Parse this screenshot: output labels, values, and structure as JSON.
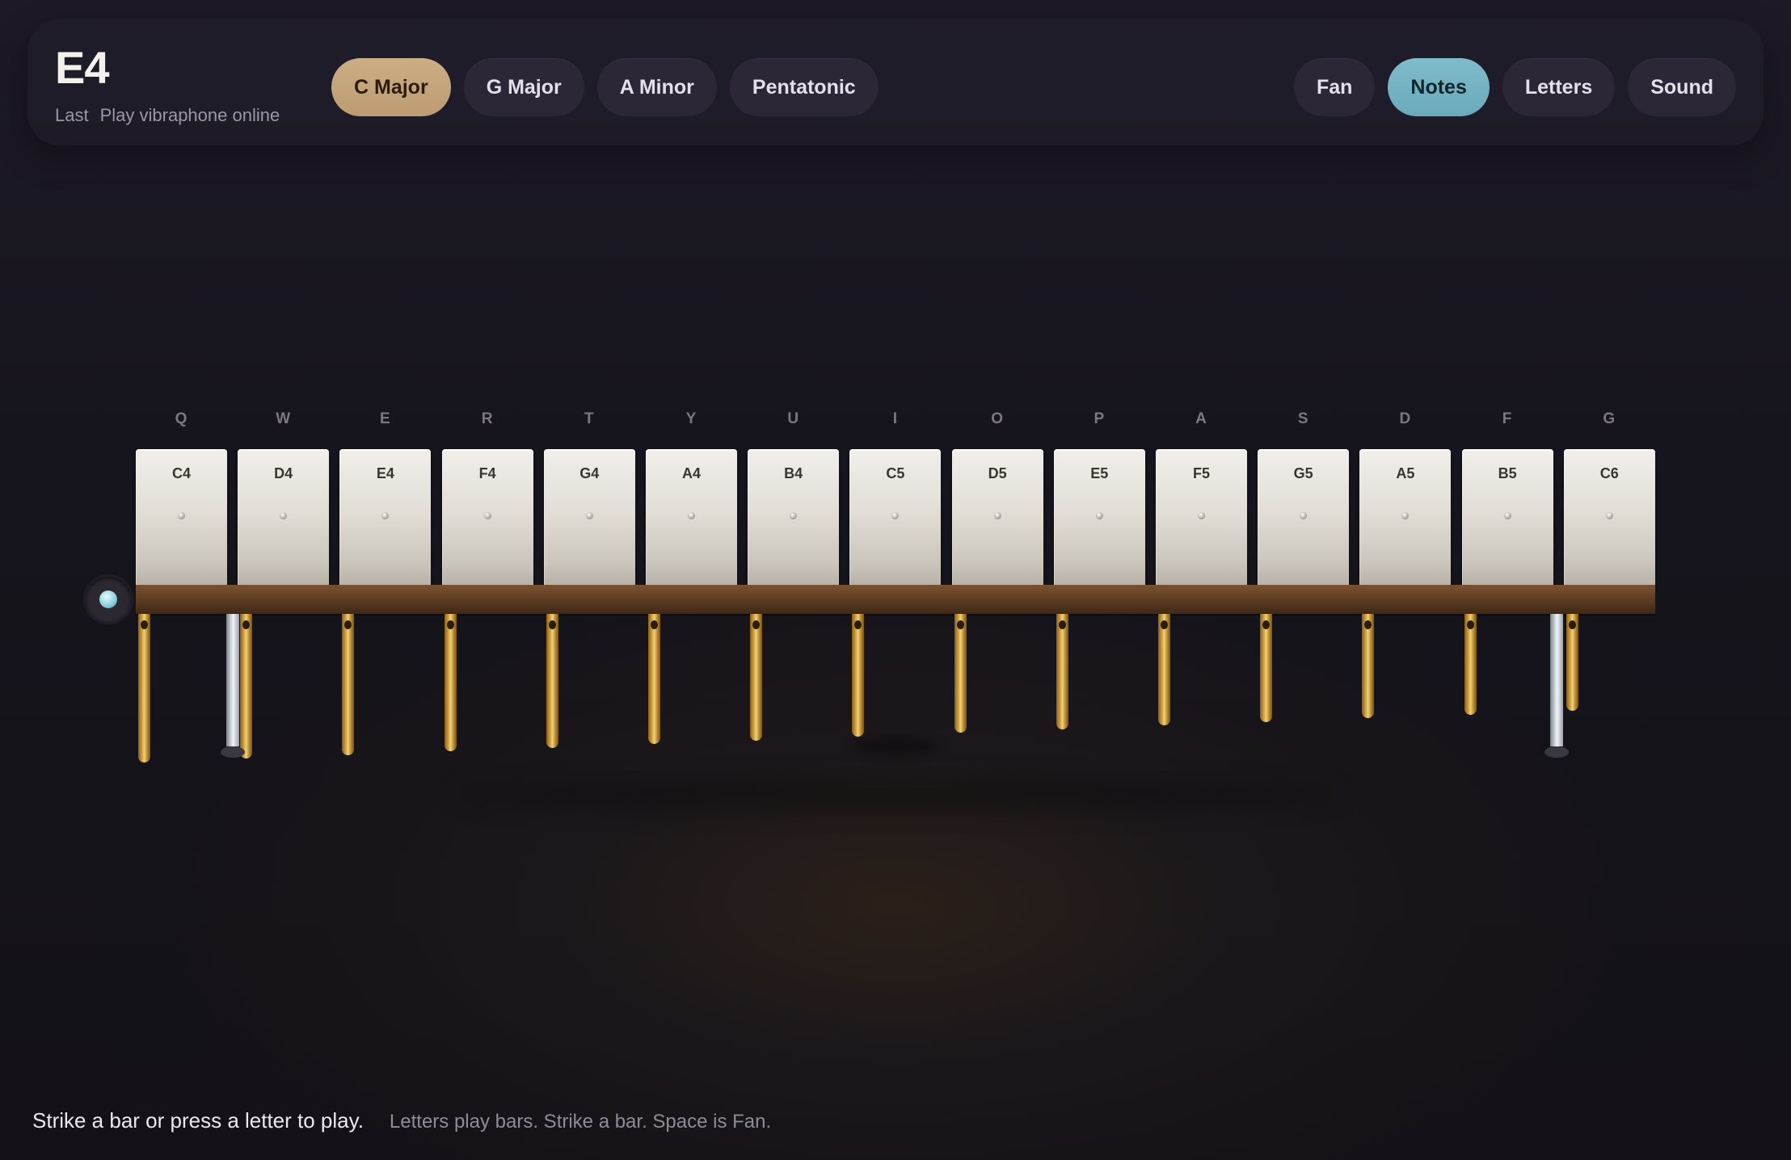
{
  "header": {
    "title": "E4",
    "subtitle_label": "Last",
    "subtitle_text": "Play vibraphone online"
  },
  "scales": [
    {
      "label": "C Major",
      "active": true
    },
    {
      "label": "G Major",
      "active": false
    },
    {
      "label": "A Minor",
      "active": false
    },
    {
      "label": "Pentatonic",
      "active": false
    }
  ],
  "toggles": [
    {
      "label": "Fan",
      "active": false
    },
    {
      "label": "Notes",
      "active": true
    },
    {
      "label": "Letters",
      "active": false
    },
    {
      "label": "Sound",
      "active": false
    }
  ],
  "keys": [
    {
      "letter": "Q",
      "note": "C4"
    },
    {
      "letter": "W",
      "note": "D4"
    },
    {
      "letter": "E",
      "note": "E4"
    },
    {
      "letter": "R",
      "note": "F4"
    },
    {
      "letter": "T",
      "note": "G4"
    },
    {
      "letter": "Y",
      "note": "A4"
    },
    {
      "letter": "U",
      "note": "B4"
    },
    {
      "letter": "I",
      "note": "C5"
    },
    {
      "letter": "O",
      "note": "D5"
    },
    {
      "letter": "P",
      "note": "E5"
    },
    {
      "letter": "A",
      "note": "F5"
    },
    {
      "letter": "S",
      "note": "G5"
    },
    {
      "letter": "D",
      "note": "A5"
    },
    {
      "letter": "F",
      "note": "B5"
    },
    {
      "letter": "G",
      "note": "C6"
    }
  ],
  "footer": {
    "instruction": "Strike a bar or press a letter to play.",
    "hint": "Letters play bars. Strike a bar. Space is Fan."
  },
  "colors": {
    "active_scale": "#c4a47a",
    "active_toggle": "#74b4c4",
    "rail": "#5e3d23",
    "resonator": "#d7a848"
  }
}
